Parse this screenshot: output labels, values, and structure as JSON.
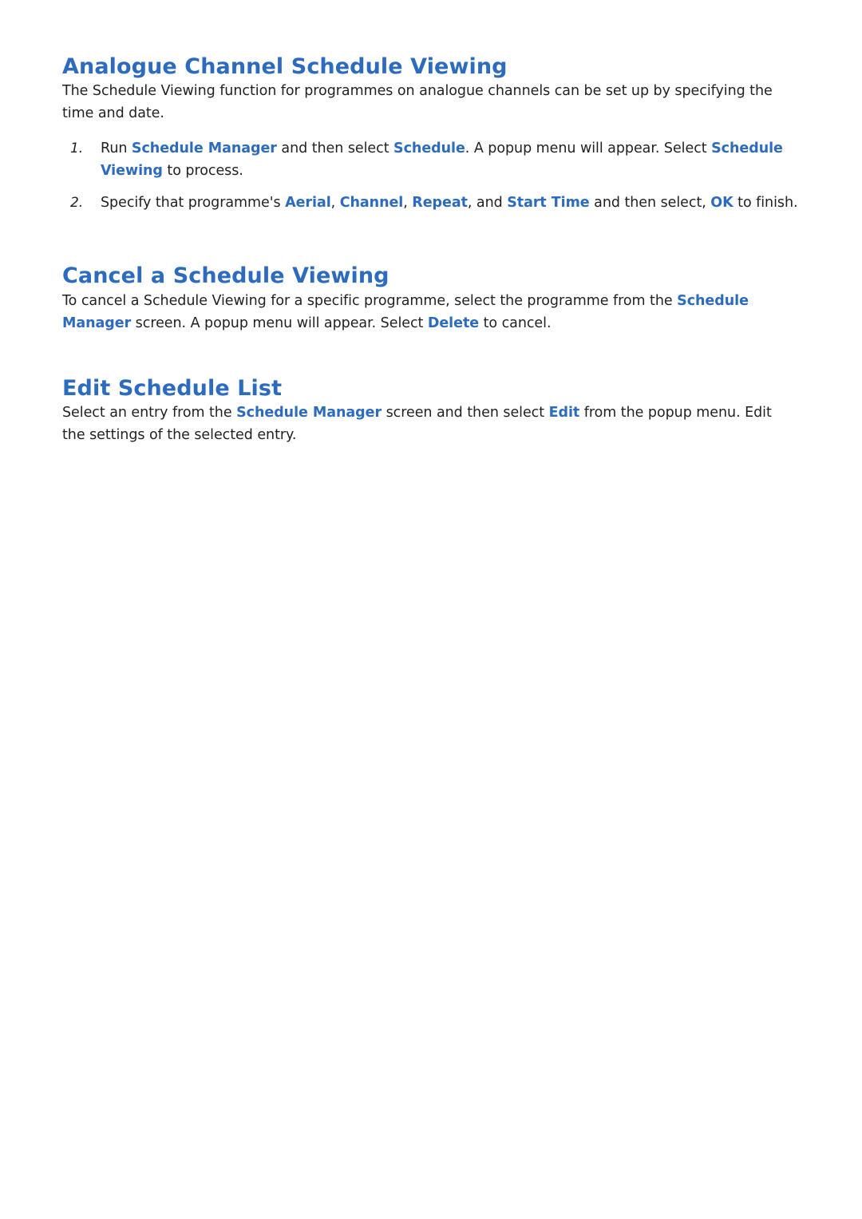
{
  "document": {
    "accent_color": "#2c6bbd",
    "text_color": "#231f20",
    "sections": [
      {
        "title": "Analogue Channel Schedule Viewing",
        "intro": {
          "parts": [
            {
              "t": "The Schedule Viewing function for programmes on analogue channels can be set up by specifying the time and date.",
              "hl": false
            }
          ]
        },
        "steps": [
          {
            "number": "1.",
            "parts": [
              {
                "t": "Run ",
                "hl": false
              },
              {
                "t": "Schedule Manager",
                "hl": true
              },
              {
                "t": " and then select ",
                "hl": false
              },
              {
                "t": "Schedule",
                "hl": true
              },
              {
                "t": ". A popup menu will appear. Select ",
                "hl": false
              },
              {
                "t": "Schedule Viewing",
                "hl": true
              },
              {
                "t": " to process.",
                "hl": false
              }
            ]
          },
          {
            "number": "2.",
            "parts": [
              {
                "t": "Specify that programme's ",
                "hl": false
              },
              {
                "t": "Aerial",
                "hl": true
              },
              {
                "t": ", ",
                "hl": false
              },
              {
                "t": "Channel",
                "hl": true
              },
              {
                "t": ", ",
                "hl": false
              },
              {
                "t": "Repeat",
                "hl": true
              },
              {
                "t": ", and ",
                "hl": false
              },
              {
                "t": "Start Time",
                "hl": true
              },
              {
                "t": " and then select, ",
                "hl": false
              },
              {
                "t": "OK",
                "hl": true
              },
              {
                "t": " to finish.",
                "hl": false
              }
            ]
          }
        ]
      },
      {
        "title": "Cancel a Schedule Viewing",
        "paragraph": {
          "parts": [
            {
              "t": "To cancel a Schedule Viewing for a specific programme, select the programme from the ",
              "hl": false
            },
            {
              "t": "Schedule Manager",
              "hl": true
            },
            {
              "t": " screen. A popup menu will appear. Select ",
              "hl": false
            },
            {
              "t": "Delete",
              "hl": true
            },
            {
              "t": " to cancel.",
              "hl": false
            }
          ]
        }
      },
      {
        "title": "Edit Schedule List",
        "paragraph": {
          "parts": [
            {
              "t": "Select an entry from the ",
              "hl": false
            },
            {
              "t": "Schedule Manager",
              "hl": true
            },
            {
              "t": " screen and then select ",
              "hl": false
            },
            {
              "t": "Edit",
              "hl": true
            },
            {
              "t": " from the popup menu. Edit the settings of the selected entry.",
              "hl": false
            }
          ]
        }
      }
    ]
  }
}
